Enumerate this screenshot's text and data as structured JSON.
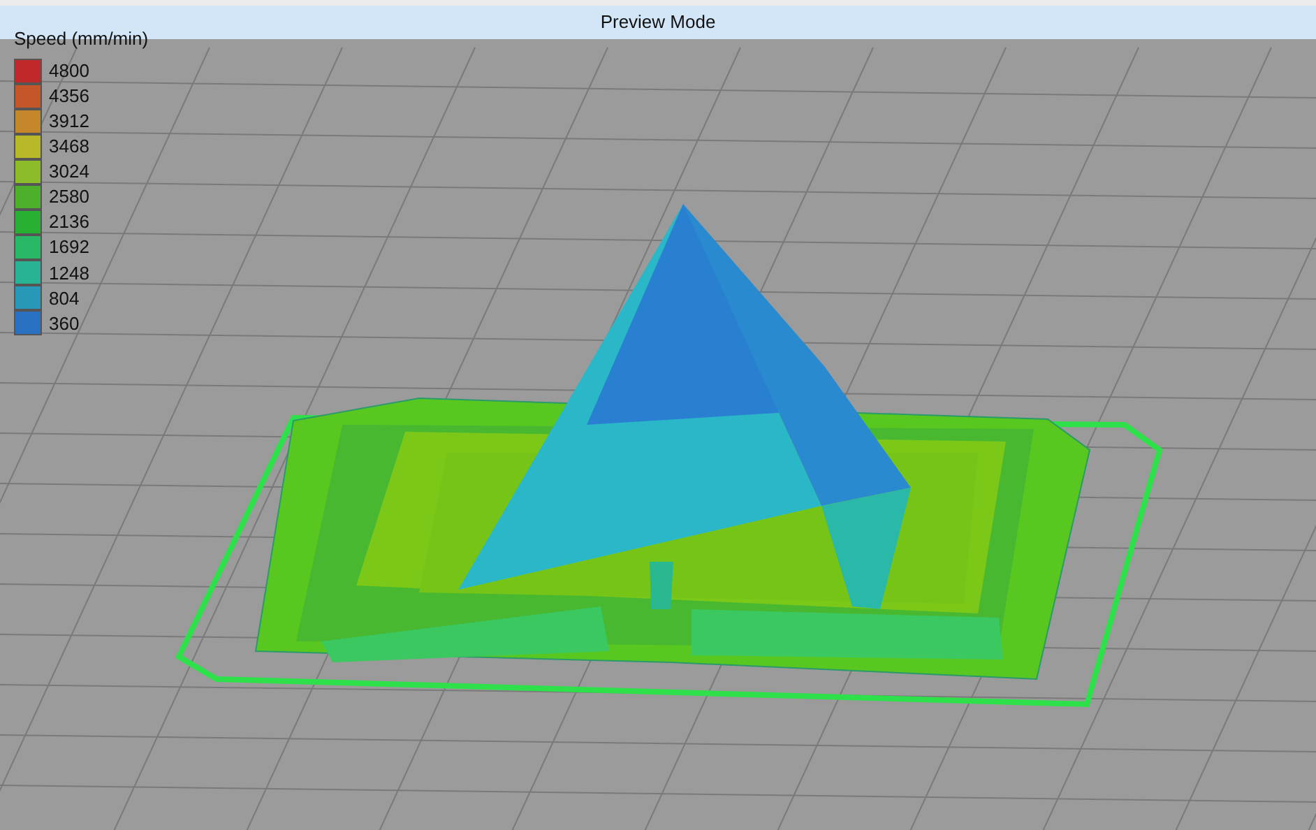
{
  "header": {
    "title": "Preview Mode"
  },
  "legend": {
    "title": "Speed (mm/min)",
    "items": [
      {
        "label": "4800",
        "color": "#c0282a"
      },
      {
        "label": "4356",
        "color": "#c4562a"
      },
      {
        "label": "3912",
        "color": "#c4882a"
      },
      {
        "label": "3468",
        "color": "#b8b828"
      },
      {
        "label": "3024",
        "color": "#8cbc2a"
      },
      {
        "label": "2580",
        "color": "#4cb02a"
      },
      {
        "label": "2136",
        "color": "#28b032"
      },
      {
        "label": "1692",
        "color": "#28b866"
      },
      {
        "label": "1248",
        "color": "#28b494"
      },
      {
        "label": "804",
        "color": "#2898b8"
      },
      {
        "label": "360",
        "color": "#2a70c0"
      }
    ]
  }
}
